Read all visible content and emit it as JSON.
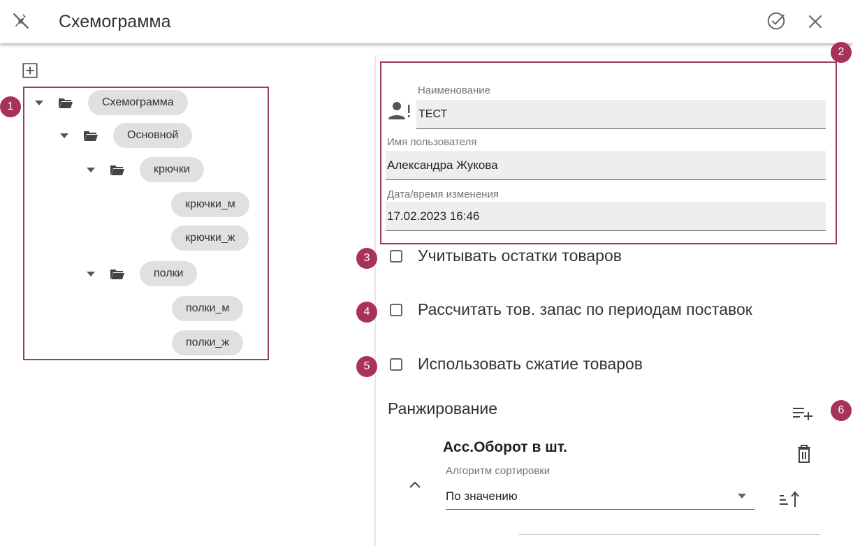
{
  "header": {
    "title": "Схемограмма",
    "icons": {
      "pin": "pin-off-icon",
      "confirm": "check-circle-icon",
      "close": "close-icon"
    }
  },
  "tree": {
    "add_icon": "plus-square-icon",
    "nodes": [
      {
        "label": "Схемограмма",
        "expanded": true
      },
      {
        "label": "Основной",
        "expanded": true
      },
      {
        "label": "крючки",
        "expanded": true
      },
      {
        "label": "крючки_м"
      },
      {
        "label": "крючки_ж"
      },
      {
        "label": "полки",
        "expanded": true
      },
      {
        "label": "полки_м"
      },
      {
        "label": "полки_ж"
      }
    ]
  },
  "markers": [
    "1",
    "2",
    "3",
    "4",
    "5",
    "6"
  ],
  "form": {
    "name_label": "Наименование",
    "name_value": "ТЕСТ",
    "user_label": "Имя пользователя",
    "user_value": "Александра Жукова",
    "date_label": "Дата/время изменения",
    "date_value": "17.02.2023 16:46"
  },
  "options": [
    {
      "label": "Учитывать остатки товаров",
      "checked": false
    },
    {
      "label": "Рассчитать тов. запас по периодам поставок",
      "checked": false
    },
    {
      "label": "Использовать сжатие товаров",
      "checked": false
    }
  ],
  "ranking": {
    "title": "Ранжирование",
    "item_title": "Асс.Оборот в шт.",
    "algo_label": "Алгоритм сортировки",
    "algo_value": "По значению"
  },
  "colors": {
    "accent": "#9b3b62",
    "marker": "#a8325a",
    "chip": "#e0e0e0"
  }
}
